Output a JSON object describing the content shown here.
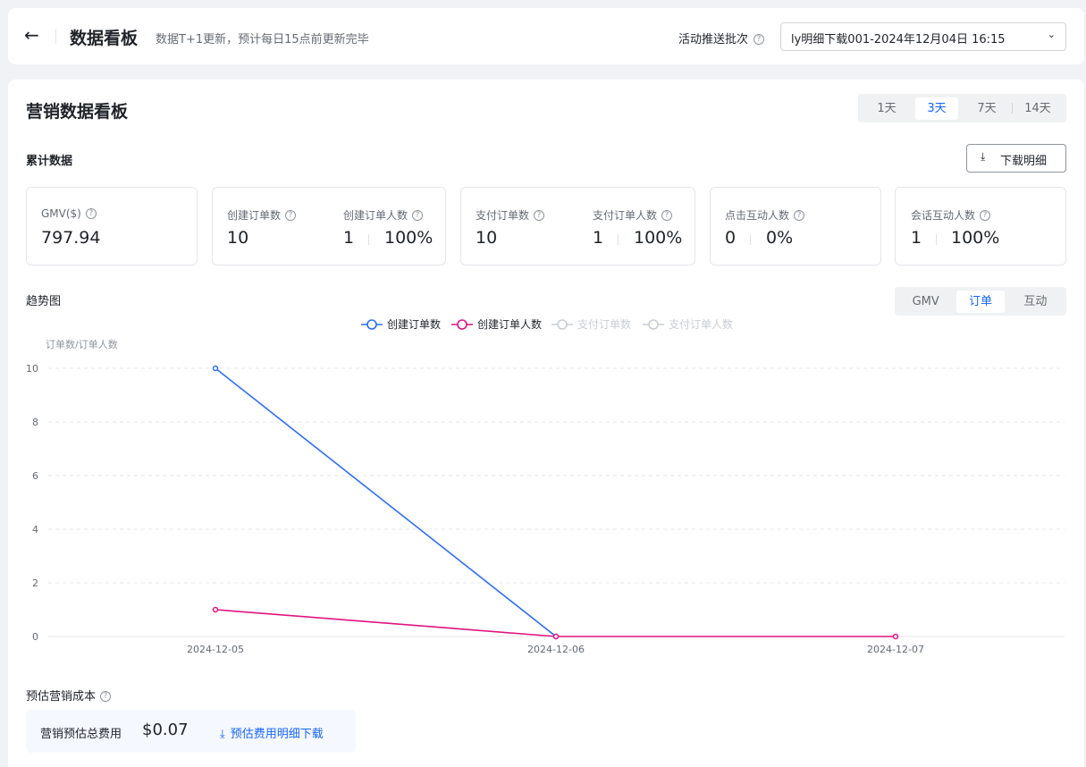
{
  "header": {
    "back_icon": "←",
    "title": "数据看板",
    "subtitle": "数据T+1更新，预计每日15点前更新完毕",
    "batch_label": "活动推送批次",
    "batch_value": "ly明细下载001-2024年12月04日 16:15"
  },
  "board": {
    "title": "营销数据看板",
    "day_options": [
      "1天",
      "3天",
      "7天",
      "14天"
    ],
    "active_day": "3天"
  },
  "cumulative": {
    "label": "累计数据",
    "download_label": "下载明细",
    "download_icon": "⤓"
  },
  "metrics": {
    "gmv": {
      "label": "GMV($)",
      "value": "797.94"
    },
    "create_orders": {
      "label": "创建订单数",
      "value": "10"
    },
    "create_buyers": {
      "label": "创建订单人数",
      "value": "1",
      "rate": "100%"
    },
    "pay_orders": {
      "label": "支付订单数",
      "value": "10"
    },
    "pay_buyers": {
      "label": "支付订单人数",
      "value": "1",
      "rate": "100%"
    },
    "click_users": {
      "label": "点击互动人数",
      "value": "0",
      "rate": "0%"
    },
    "chat_users": {
      "label": "会话互动人数",
      "value": "1",
      "rate": "100%"
    }
  },
  "trend": {
    "label": "趋势图",
    "view_options": [
      "GMV",
      "订单",
      "互动"
    ],
    "active_view": "订单"
  },
  "chart_data": {
    "type": "line",
    "ylabel": "订单数/订单人数",
    "x": [
      "2024-12-05",
      "2024-12-06",
      "2024-12-07"
    ],
    "ylim": [
      0,
      10
    ],
    "yticks": [
      0,
      2,
      4,
      6,
      8,
      10
    ],
    "grid": true,
    "legend_position": "top-center",
    "series": [
      {
        "name": "创建订单数",
        "values": [
          10,
          0,
          null
        ],
        "color": "#2b6cff",
        "visible": true
      },
      {
        "name": "创建订单人数",
        "values": [
          1,
          0,
          0
        ],
        "color": "#e0137f",
        "visible": true
      },
      {
        "name": "支付订单数",
        "values": [],
        "color": "#c9cdd4",
        "visible": false
      },
      {
        "name": "支付订单人数",
        "values": [],
        "color": "#c9cdd4",
        "visible": false
      }
    ]
  },
  "cost": {
    "label": "预估营销成本",
    "total_label": "营销预估总费用",
    "total_value": "$0.07",
    "download_icon": "⤓",
    "download_label": "预估费用明细下载"
  },
  "icons": {
    "help": "?",
    "chevron": "⌄"
  }
}
